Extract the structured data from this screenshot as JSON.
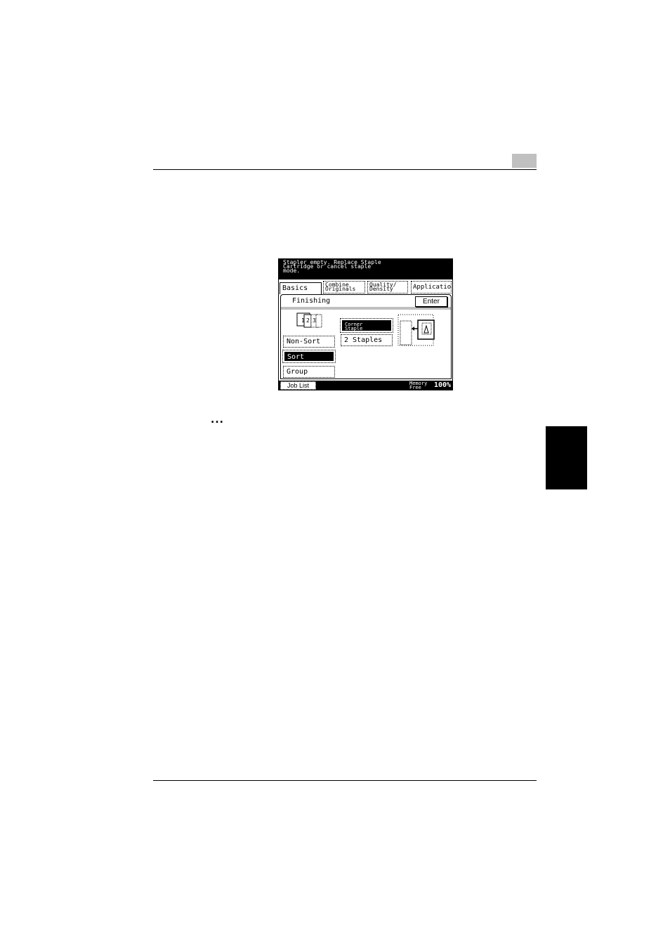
{
  "screen": {
    "message": "Stapler empty. Replace Staple\nCartridge or cancel staple\nmode.",
    "tabs": {
      "basics": "Basics",
      "combine": "Combine\nOriginals",
      "quality": "Quality/\nDensity",
      "application": "Application"
    },
    "panel_title": "Finishing",
    "enter_label": "Enter",
    "sort_options": {
      "non_sort": "Non-Sort",
      "sort": "Sort",
      "group": "Group"
    },
    "staple_options": {
      "corner": "Corner\nStaple",
      "two": "2 Staples"
    },
    "bottom": {
      "job_list": "Job List",
      "memory_label": "Memory\nFree",
      "memory_value": "100%"
    },
    "collate_icon_text": "123"
  },
  "page": {
    "ellipsis": "..."
  }
}
